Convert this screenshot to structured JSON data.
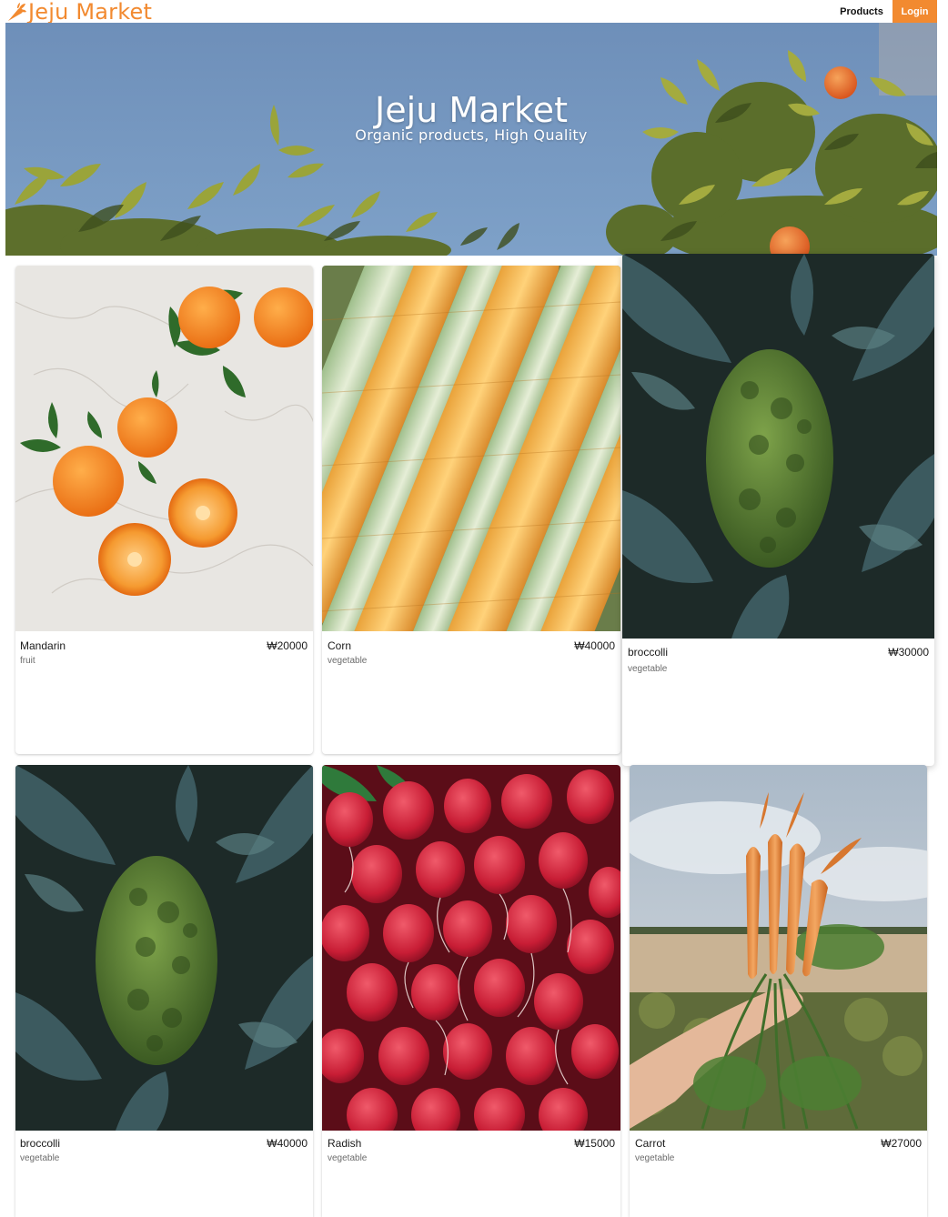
{
  "navbar": {
    "brand": "Jeju Market",
    "brand_icon": "carrot-icon",
    "products_label": "Products",
    "login_label": "Login",
    "accent_color": "#f28a30"
  },
  "hero": {
    "title": "Jeju Market",
    "subtitle": "Organic products, High Quality",
    "image": "mandarin-branches-sky-image"
  },
  "products": [
    {
      "name": "Mandarin",
      "price": "₩20000",
      "category": "fruit",
      "image": "mandarin-photo"
    },
    {
      "name": "Corn",
      "price": "₩40000",
      "category": "vegetable",
      "image": "corn-photo"
    },
    {
      "name": "broccolli",
      "price": "₩30000",
      "category": "vegetable",
      "image": "broccoli-photo"
    },
    {
      "name": "broccolli",
      "price": "₩40000",
      "category": "vegetable",
      "image": "broccoli-photo"
    },
    {
      "name": "Radish",
      "price": "₩15000",
      "category": "vegetable",
      "image": "radish-photo"
    },
    {
      "name": "Carrot",
      "price": "₩27000",
      "category": "vegetable",
      "image": "carrot-photo"
    }
  ]
}
